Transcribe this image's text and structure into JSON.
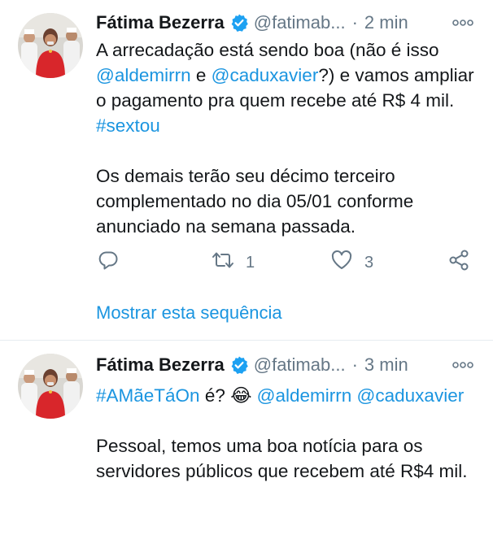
{
  "colors": {
    "link": "#1b95e0",
    "secondary_text": "#657786",
    "verified_badge": "#1da1f2",
    "divider": "#e6ecf0"
  },
  "tweets": [
    {
      "author": {
        "display_name": "Fátima Bezerra",
        "handle": "@fatimab...",
        "verified_icon": "verified-badge-icon"
      },
      "separator": "·",
      "time": "2 min",
      "body": {
        "p1_t1": "A arrecadação está sendo boa (não é isso ",
        "p1_mention1": "@aldemirrn",
        "p1_t2": " e ",
        "p1_mention2": "@caduxavier",
        "p1_t3": "?)  e vamos ampliar o pagamento pra quem recebe até R$ 4 mil. ",
        "p1_hashtag": "#sextou",
        "p2": "Os demais terão seu décimo terceiro complementado no dia 05/01 conforme anunciado na semana passada."
      },
      "actions": {
        "reply_icon": "reply-icon",
        "retweet_icon": "retweet-icon",
        "retweet_count": "1",
        "like_icon": "heart-icon",
        "like_count": "3",
        "share_icon": "share-icon"
      },
      "show_thread": "Mostrar esta sequência"
    },
    {
      "author": {
        "display_name": "Fátima Bezerra",
        "handle": "@fatimab...",
        "verified_icon": "verified-badge-icon"
      },
      "separator": "·",
      "time": "3 min",
      "body": {
        "p1_hashtag": "#AMãeTáOn",
        "p1_t1": " é? ",
        "p1_emoji": "😂",
        "p1_t2": " ",
        "p1_mention1": "@aldemirrn",
        "p1_t3": " ",
        "p1_mention2": "@caduxavier",
        "p2": "Pessoal, temos uma boa notícia para os servidores públicos que recebem até R$4 mil."
      }
    }
  ]
}
